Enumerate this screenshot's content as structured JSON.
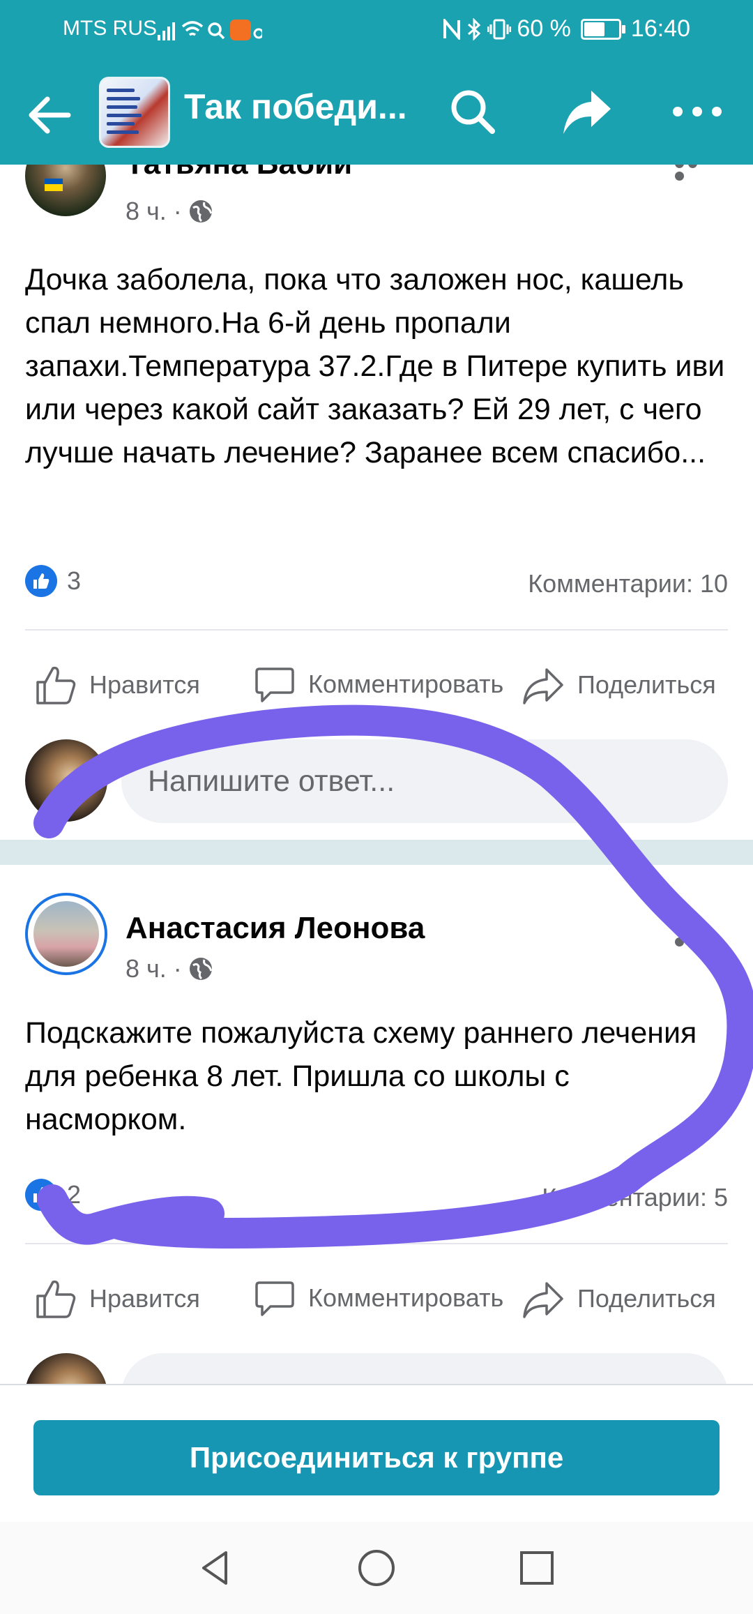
{
  "status_bar": {
    "carrier": "MTS RUS",
    "battery": "60 %",
    "time": "16:40"
  },
  "app_bar": {
    "title": "Так победи..."
  },
  "posts": [
    {
      "author": "Татьяна Бабий",
      "time": "8 ч. ·",
      "text": "Дочка заболела, пока что заложен нос, кашель спал немного.На 6-й день пропали запахи.Температура 37.2.Где в Питере купить иви или через какой сайт заказать? Ей 29 лет, с чего лучше начать лечение? Заранее всем спасибо...",
      "likes": "3",
      "comments": "Комментарии: 10"
    },
    {
      "author": "Анастасия Леонова",
      "time": "8 ч. ·",
      "text": "Подскажите пожалуйста схему раннего лечения для ребенка 8 лет. Пришла со школы с насморком.",
      "likes": "2",
      "comments": "Комментарии: 5"
    }
  ],
  "actions": {
    "like": "Нравится",
    "comment": "Комментировать",
    "share": "Поделиться"
  },
  "reply_placeholder": "Напишите ответ...",
  "join_button": "Присоединиться к группе",
  "colors": {
    "header": "#1ba2b1",
    "join": "#1696b2",
    "scribble": "#7862ec",
    "like": "#1b74e4"
  }
}
